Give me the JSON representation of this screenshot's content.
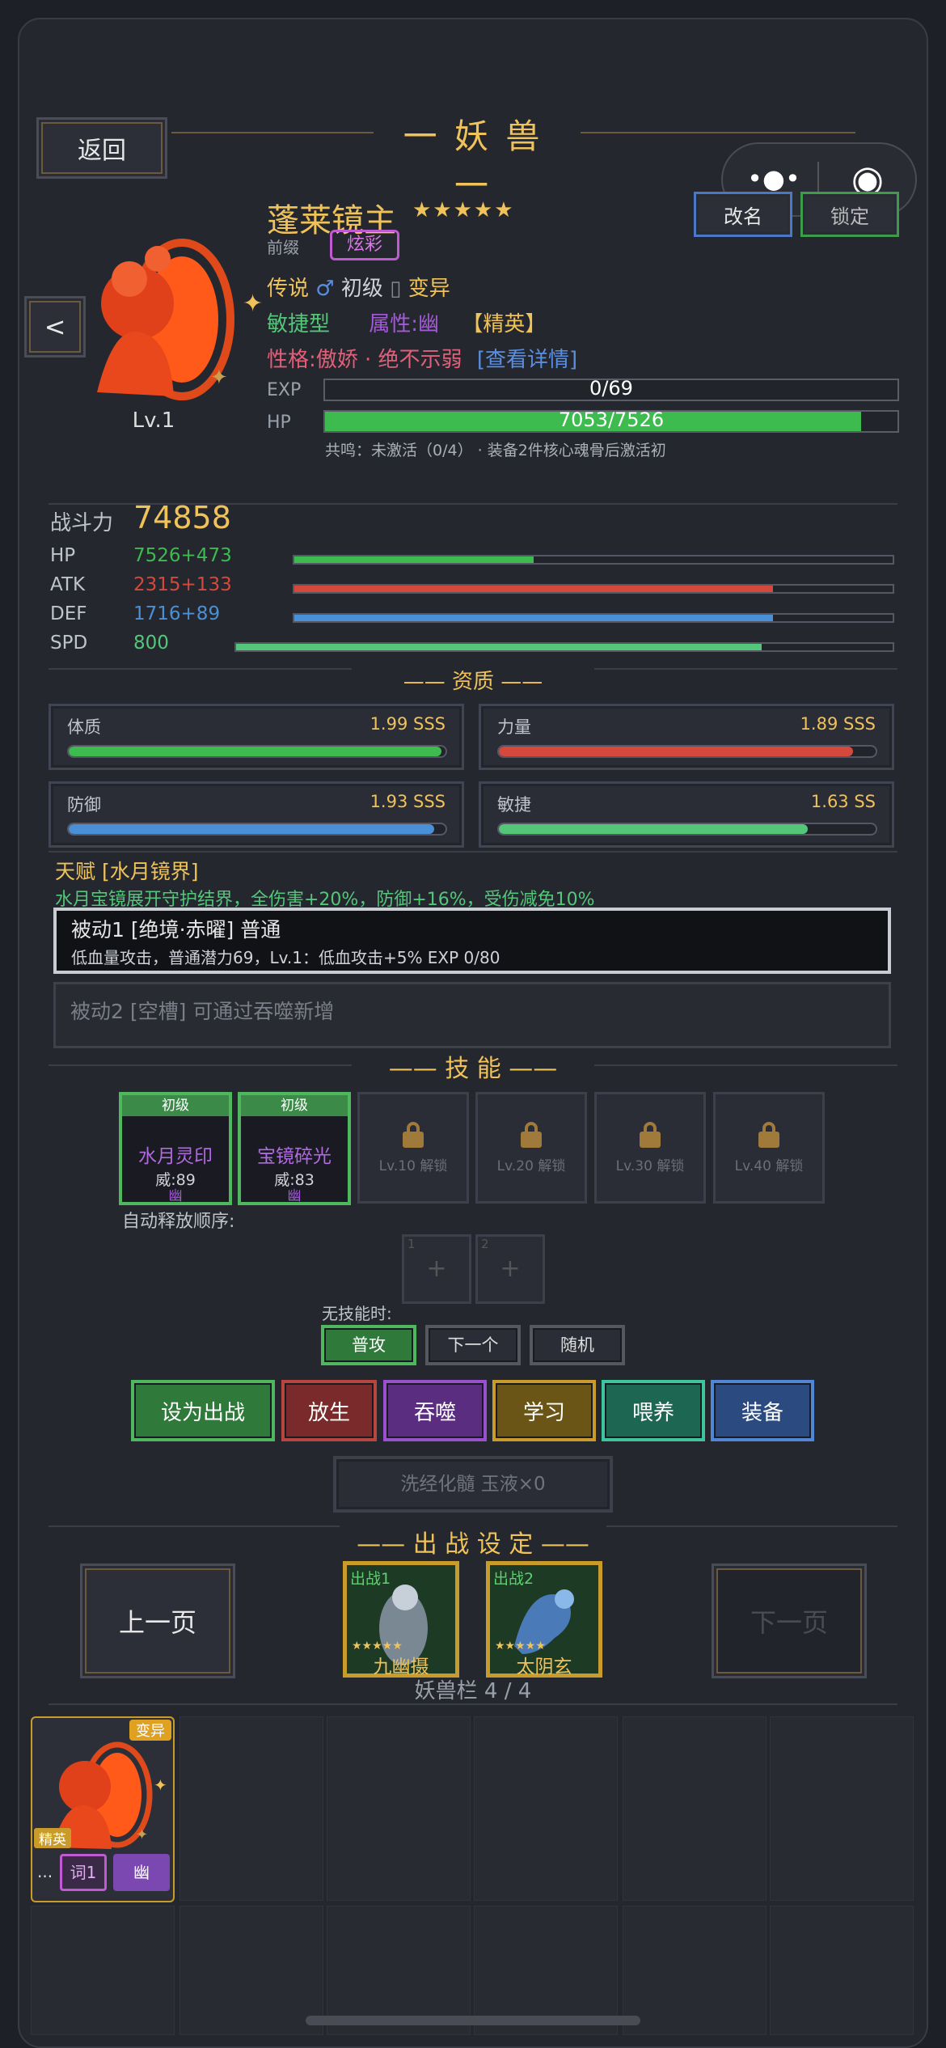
{
  "header": {
    "back_label": "返回",
    "title": "一 妖 兽 一",
    "rename_label": "改名",
    "lock_label": "锁定",
    "prev_arrow": "<"
  },
  "beast": {
    "name": "蓬莱镜主",
    "stars": "★★★★★",
    "prefix_label": "前缀",
    "prefix_badge": "炫彩",
    "level": "Lv.1",
    "line1": {
      "rarity": "传说",
      "gender": "♂",
      "stage": "初级",
      "sep": "▯",
      "variant": "变异"
    },
    "line2": {
      "type": "敏捷型",
      "attr": "属性:幽",
      "tier": "【精英】"
    },
    "line3": {
      "personality": "性格:傲娇 · 绝不示弱",
      "detail_link": "[查看详情]"
    },
    "exp_label": "EXP",
    "exp_value": "0/69",
    "exp_fraction": 0,
    "hp_label": "HP",
    "hp_value": "7053/7526",
    "hp_fraction": 0.937,
    "resonance": "共鸣：未激活（0/4） · 装备2件核心魂骨后激活初"
  },
  "combat": {
    "label": "战斗力",
    "value": "74858",
    "stats": [
      {
        "name": "HP",
        "value": "7526+473",
        "fraction": 0.4,
        "color": "#3dbb4f"
      },
      {
        "name": "ATK",
        "value": "2315+133",
        "fraction": 0.8,
        "color": "#d4493c"
      },
      {
        "name": "DEF",
        "value": "1716+89",
        "fraction": 0.8,
        "color": "#4a90d6"
      },
      {
        "name": "SPD",
        "value": "800",
        "fraction": 0.8,
        "color": "#54c67a"
      }
    ]
  },
  "aptitude": {
    "title": "—— 资质 ——",
    "items": [
      {
        "name": "体质",
        "grade": "1.99 SSS",
        "fraction": 0.99,
        "color": "#3dbb4f"
      },
      {
        "name": "力量",
        "grade": "1.89 SSS",
        "fraction": 0.94,
        "color": "#d4493c"
      },
      {
        "name": "防御",
        "grade": "1.93 SSS",
        "fraction": 0.97,
        "color": "#4a90d6"
      },
      {
        "name": "敏捷",
        "grade": "1.63 SS",
        "fraction": 0.82,
        "color": "#54c67a"
      }
    ]
  },
  "talent": {
    "title": "天赋 [水月镜界]",
    "desc": "水月宝镜展开守护结界，全伤害+20%，防御+16%，受伤减免10%"
  },
  "passives": [
    {
      "title": "被动1 [绝境·赤曜] 普通",
      "desc": "低血量攻击，普通潜力69，Lv.1：低血攻击+5%  EXP 0/80"
    },
    {
      "title": "被动2 [空槽] 可通过吞噬新增"
    }
  ],
  "skills": {
    "title": "—— 技 能 ——",
    "learned": [
      {
        "tier": "初级",
        "name": "水月灵印",
        "power": "威:89",
        "attr": "幽"
      },
      {
        "tier": "初级",
        "name": "宝镜碎光",
        "power": "威:83",
        "attr": "幽"
      }
    ],
    "locked": [
      "Lv.10 解锁",
      "Lv.20 解锁",
      "Lv.30 解锁",
      "Lv.40 解锁"
    ],
    "auto_order_label": "自动释放顺序:",
    "order_slots": [
      {
        "num": "1",
        "plus": "+"
      },
      {
        "num": "2",
        "plus": "+"
      }
    ],
    "no_skill_label": "无技能时:",
    "modes": [
      "普攻",
      "下一个",
      "随机"
    ]
  },
  "actions": [
    {
      "label": "设为出战",
      "bg": "#2f7a3a",
      "border": "#4fb75e"
    },
    {
      "label": "放生",
      "bg": "#7a2a2a",
      "border": "#b8463f"
    },
    {
      "label": "吞噬",
      "bg": "#5b2d80",
      "border": "#9a4fd0"
    },
    {
      "label": "学习",
      "bg": "#6b5516",
      "border": "#c99b2a"
    },
    {
      "label": "喂养",
      "bg": "#1c6652",
      "border": "#3ec49a"
    },
    {
      "label": "装备",
      "bg": "#2a4a80",
      "border": "#4f86d6"
    }
  ],
  "refine": {
    "label": "洗经化髓  玉液×0"
  },
  "battle": {
    "title": "—— 出 战 设 定 ——",
    "prev": "上一页",
    "next": "下一页",
    "slots": [
      {
        "tag": "出战1",
        "stars": "★★★★★",
        "name": "九幽摄"
      },
      {
        "tag": "出战2",
        "stars": "★★★★★",
        "name": "太阴玄"
      }
    ],
    "roster_label": "妖兽栏 4 / 4"
  },
  "roster_card": {
    "badge_top": "变异",
    "badge_bottom": "精英",
    "dots": "...",
    "btn1": "词1",
    "btn2": "幽"
  },
  "capsule": {
    "more": "•●•",
    "close": "◉"
  }
}
